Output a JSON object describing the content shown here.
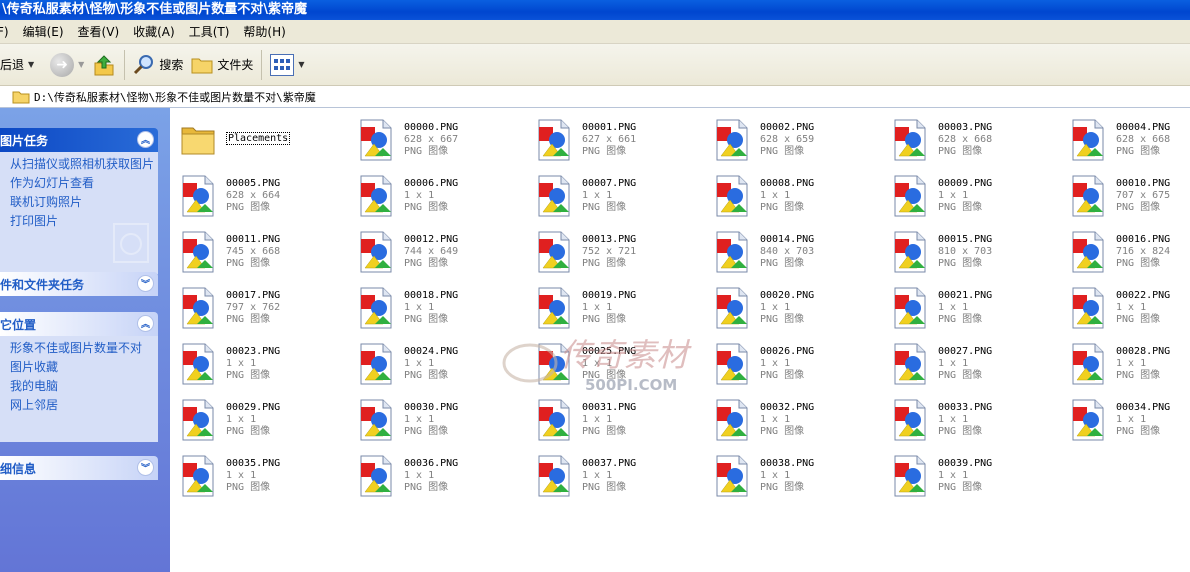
{
  "window": {
    "title": "\\传奇私服素材\\怪物\\形象不佳或图片数量不对\\紫帝魔"
  },
  "menubar": {
    "items": [
      "F)",
      "编辑(E)",
      "查看(V)",
      "收藏(A)",
      "工具(T)",
      "帮助(H)"
    ]
  },
  "toolbar": {
    "back_label": "后退",
    "search_label": "搜索",
    "folders_label": "文件夹"
  },
  "address": {
    "path": "D:\\传奇私服素材\\怪物\\形象不佳或图片数量不对\\紫帝魔"
  },
  "sidebar": {
    "picture_tasks": {
      "title": "图片任务",
      "links": [
        "从扫描仪或照相机获取图片",
        "作为幻灯片查看",
        "联机订购照片",
        "打印图片"
      ]
    },
    "file_tasks": {
      "title": "件和文件夹任务"
    },
    "other_places": {
      "title": "它位置",
      "links": [
        "形象不佳或图片数量不对",
        "图片收藏",
        "我的电脑",
        "网上邻居"
      ]
    },
    "details": {
      "title": "细信息"
    }
  },
  "folder": {
    "name": "Placements"
  },
  "files": [
    {
      "name": "00000.PNG",
      "dims": "628 x 667",
      "type": "PNG 图像"
    },
    {
      "name": "00001.PNG",
      "dims": "627 x 661",
      "type": "PNG 图像"
    },
    {
      "name": "00002.PNG",
      "dims": "628 x 659",
      "type": "PNG 图像"
    },
    {
      "name": "00003.PNG",
      "dims": "628 x 668",
      "type": "PNG 图像"
    },
    {
      "name": "00004.PNG",
      "dims": "628 x 668",
      "type": "PNG 图像"
    },
    {
      "name": "00005.PNG",
      "dims": "628 x 664",
      "type": "PNG 图像"
    },
    {
      "name": "00006.PNG",
      "dims": "1 x 1",
      "type": "PNG 图像"
    },
    {
      "name": "00007.PNG",
      "dims": "1 x 1",
      "type": "PNG 图像"
    },
    {
      "name": "00008.PNG",
      "dims": "1 x 1",
      "type": "PNG 图像"
    },
    {
      "name": "00009.PNG",
      "dims": "1 x 1",
      "type": "PNG 图像"
    },
    {
      "name": "00010.PNG",
      "dims": "707 x 675",
      "type": "PNG 图像"
    },
    {
      "name": "00011.PNG",
      "dims": "745 x 668",
      "type": "PNG 图像"
    },
    {
      "name": "00012.PNG",
      "dims": "744 x 649",
      "type": "PNG 图像"
    },
    {
      "name": "00013.PNG",
      "dims": "752 x 721",
      "type": "PNG 图像"
    },
    {
      "name": "00014.PNG",
      "dims": "840 x 703",
      "type": "PNG 图像"
    },
    {
      "name": "00015.PNG",
      "dims": "810 x 703",
      "type": "PNG 图像"
    },
    {
      "name": "00016.PNG",
      "dims": "716 x 824",
      "type": "PNG 图像"
    },
    {
      "name": "00017.PNG",
      "dims": "797 x 762",
      "type": "PNG 图像"
    },
    {
      "name": "00018.PNG",
      "dims": "1 x 1",
      "type": "PNG 图像"
    },
    {
      "name": "00019.PNG",
      "dims": "1 x 1",
      "type": "PNG 图像"
    },
    {
      "name": "00020.PNG",
      "dims": "1 x 1",
      "type": "PNG 图像"
    },
    {
      "name": "00021.PNG",
      "dims": "1 x 1",
      "type": "PNG 图像"
    },
    {
      "name": "00022.PNG",
      "dims": "1 x 1",
      "type": "PNG 图像"
    },
    {
      "name": "00023.PNG",
      "dims": "1 x 1",
      "type": "PNG 图像"
    },
    {
      "name": "00024.PNG",
      "dims": "1 x 1",
      "type": "PNG 图像"
    },
    {
      "name": "00025.PNG",
      "dims": "1 x 1",
      "type": "PNG 图像"
    },
    {
      "name": "00026.PNG",
      "dims": "1 x 1",
      "type": "PNG 图像"
    },
    {
      "name": "00027.PNG",
      "dims": "1 x 1",
      "type": "PNG 图像"
    },
    {
      "name": "00028.PNG",
      "dims": "1 x 1",
      "type": "PNG 图像"
    },
    {
      "name": "00029.PNG",
      "dims": "1 x 1",
      "type": "PNG 图像"
    },
    {
      "name": "00030.PNG",
      "dims": "1 x 1",
      "type": "PNG 图像"
    },
    {
      "name": "00031.PNG",
      "dims": "1 x 1",
      "type": "PNG 图像"
    },
    {
      "name": "00032.PNG",
      "dims": "1 x 1",
      "type": "PNG 图像"
    },
    {
      "name": "00033.PNG",
      "dims": "1 x 1",
      "type": "PNG 图像"
    },
    {
      "name": "00034.PNG",
      "dims": "1 x 1",
      "type": "PNG 图像"
    },
    {
      "name": "00035.PNG",
      "dims": "1 x 1",
      "type": "PNG 图像"
    },
    {
      "name": "00036.PNG",
      "dims": "1 x 1",
      "type": "PNG 图像"
    },
    {
      "name": "00037.PNG",
      "dims": "1 x 1",
      "type": "PNG 图像"
    },
    {
      "name": "00038.PNG",
      "dims": "1 x 1",
      "type": "PNG 图像"
    },
    {
      "name": "00039.PNG",
      "dims": "1 x 1",
      "type": "PNG 图像"
    }
  ],
  "watermark": {
    "title": "传奇素材",
    "site": "500PI.COM"
  }
}
